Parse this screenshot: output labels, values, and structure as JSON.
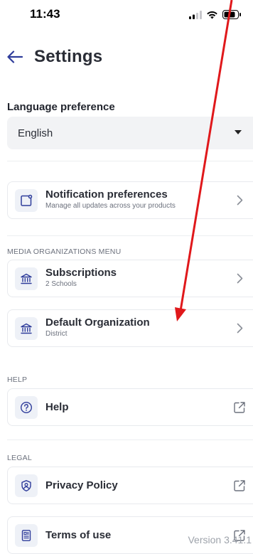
{
  "status_bar": {
    "time": "11:43"
  },
  "header": {
    "title": "Settings"
  },
  "language": {
    "label": "Language preference",
    "selected": "English"
  },
  "notification": {
    "title": "Notification preferences",
    "subtitle": "Manage all updates across your products"
  },
  "media_section": {
    "label": "MEDIA ORGANIZATIONS MENU",
    "items": [
      {
        "title": "Subscriptions",
        "subtitle": "2 Schools"
      },
      {
        "title": "Default Organization",
        "subtitle": "District"
      }
    ]
  },
  "help_section": {
    "label": "HELP",
    "item": {
      "title": "Help"
    }
  },
  "legal_section": {
    "label": "LEGAL",
    "items": [
      {
        "title": "Privacy Policy"
      },
      {
        "title": "Terms of use"
      }
    ]
  },
  "version": "Version 3.41.1",
  "icons": {
    "back": "arrow-left-icon",
    "notification": "notification-square-icon",
    "organization": "bank-building-icon",
    "help": "question-circle-icon",
    "privacy": "shield-user-icon",
    "terms": "document-icon",
    "external": "external-link-icon",
    "chevron": "chevron-right-icon"
  },
  "colors": {
    "accent": "#2f3d9b",
    "annotation": "#e0181b"
  }
}
